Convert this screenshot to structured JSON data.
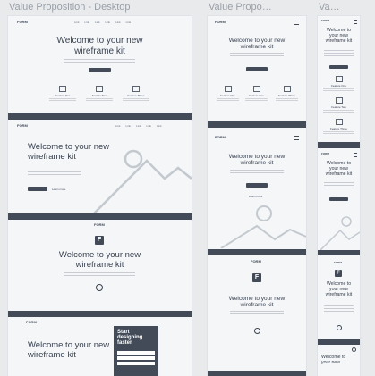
{
  "columns": [
    {
      "title": "Value Proposition - Desktop"
    },
    {
      "title": "Value Propo…"
    },
    {
      "title": "Va…"
    }
  ],
  "brand": {
    "logo": "FORM",
    "logo_letter": "F"
  },
  "nav": {
    "links": [
      "Link",
      "Link",
      "Link",
      "Link",
      "Link",
      "Link"
    ]
  },
  "hero": {
    "line1": "Welcome to your new",
    "line2": "wireframe kit",
    "small_line1": "Welcome to",
    "small_line2": "your new",
    "small_line3": "wireframe kit"
  },
  "features": [
    {
      "label": "Feature One"
    },
    {
      "label": "Feature Two"
    },
    {
      "label": "Feature Three"
    }
  ],
  "secondary_link": "Learn more",
  "signup": {
    "title": "Start designing faster"
  },
  "colors": {
    "band": "#434b59",
    "frame": "#f4f6f8",
    "canvas": "#e9eaec"
  }
}
